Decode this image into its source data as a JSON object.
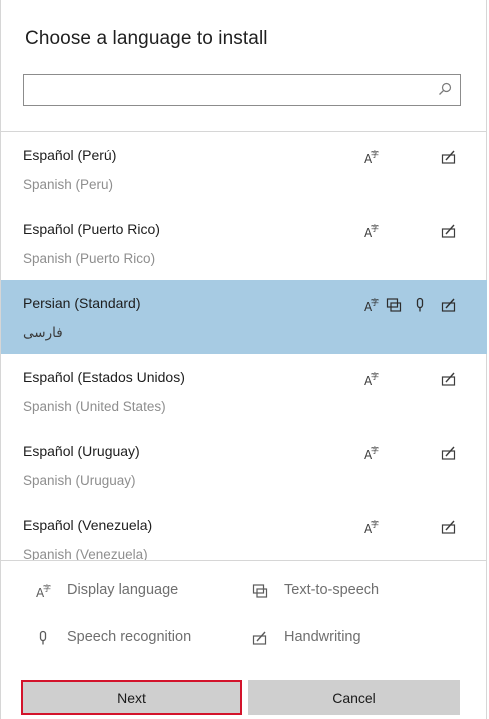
{
  "dialog": {
    "title": "Choose a language to install",
    "search": {
      "value": "",
      "placeholder": ""
    }
  },
  "languages": [
    {
      "name": "Español (Perú)",
      "native": "Spanish (Peru)",
      "features": [
        "display-language-icon",
        "handwriting-icon"
      ],
      "selected": false
    },
    {
      "name": "Español (Puerto Rico)",
      "native": "Spanish (Puerto Rico)",
      "features": [
        "display-language-icon",
        "handwriting-icon"
      ],
      "selected": false
    },
    {
      "name": "Persian (Standard)",
      "native": "فارسی",
      "features": [
        "display-language-icon",
        "text-to-speech-icon",
        "speech-recognition-icon",
        "handwriting-icon"
      ],
      "selected": true
    },
    {
      "name": "Español (Estados Unidos)",
      "native": "Spanish (United States)",
      "features": [
        "display-language-icon",
        "handwriting-icon"
      ],
      "selected": false
    },
    {
      "name": "Español (Uruguay)",
      "native": "Spanish (Uruguay)",
      "features": [
        "display-language-icon",
        "handwriting-icon"
      ],
      "selected": false
    },
    {
      "name": "Español (Venezuela)",
      "native": "Spanish (Venezuela)",
      "features": [
        "display-language-icon",
        "handwriting-icon"
      ],
      "selected": false
    }
  ],
  "legend": {
    "display_language": "Display language",
    "text_to_speech": "Text-to-speech",
    "speech_recognition": "Speech recognition",
    "handwriting": "Handwriting"
  },
  "buttons": {
    "next": "Next",
    "cancel": "Cancel"
  },
  "colors": {
    "selected_row": "#a7cbe3",
    "next_outline": "#d3132b",
    "button_bg": "#cfcfcf",
    "icon": "#3c3c3c"
  }
}
